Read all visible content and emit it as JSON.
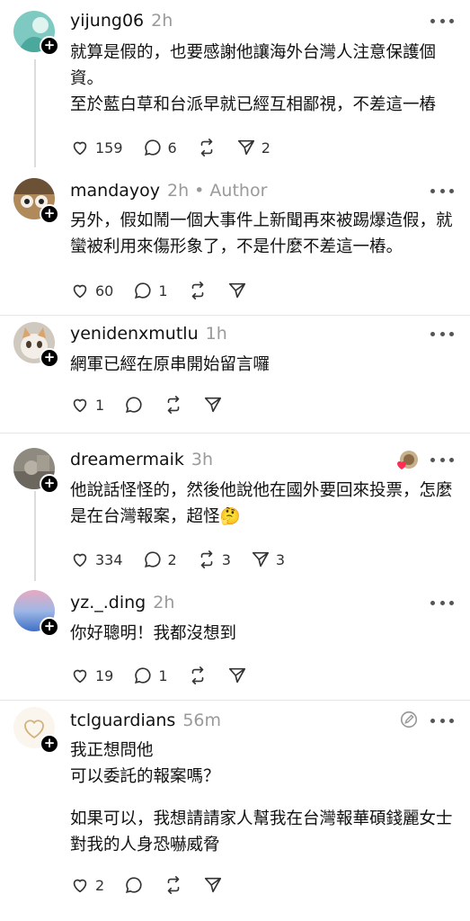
{
  "comments": [
    {
      "username": "yijung06",
      "time": "2h",
      "lines": [
        "就算是假的，也要感謝他讓海外台灣人注意保護個資。",
        "至於藍白草和台派早就已經互相鄙視，不差這一樁"
      ],
      "likes": "159",
      "replies": "6",
      "reposts": "",
      "shares": "2"
    },
    {
      "username": "mandayoy",
      "time": "2h • Author",
      "lines": [
        "另外，假如鬧一個大事件上新聞再來被踢爆造假，就蠻被利用來傷形象了，不是什麼不差這一樁。"
      ],
      "likes": "60",
      "replies": "1",
      "reposts": "",
      "shares": ""
    },
    {
      "username": "yenidenxmutlu",
      "time": "1h",
      "lines": [
        "網軍已經在原串開始留言囉"
      ],
      "likes": "1",
      "replies": "",
      "reposts": "",
      "shares": ""
    },
    {
      "username": "dreamermaik",
      "time": "3h",
      "lines": [
        "他說話怪怪的，然後他說他在國外要回來投票，怎麼是在台灣報案，超怪🤔"
      ],
      "likes": "334",
      "replies": "2",
      "reposts": "3",
      "shares": "3"
    },
    {
      "username": "yz._.ding",
      "time": "2h",
      "lines": [
        "你好聰明！我都沒想到"
      ],
      "likes": "19",
      "replies": "1",
      "reposts": "",
      "shares": ""
    },
    {
      "username": "tclguardians",
      "time": "56m",
      "lines": [
        "我正想問他",
        "可以委託的報案嗎？",
        "",
        "如果可以，我想請請家人幫我在台灣報華碩錢麗女士對我的人身恐嚇威脅"
      ],
      "likes": "2",
      "replies": "",
      "reposts": "",
      "shares": ""
    }
  ]
}
